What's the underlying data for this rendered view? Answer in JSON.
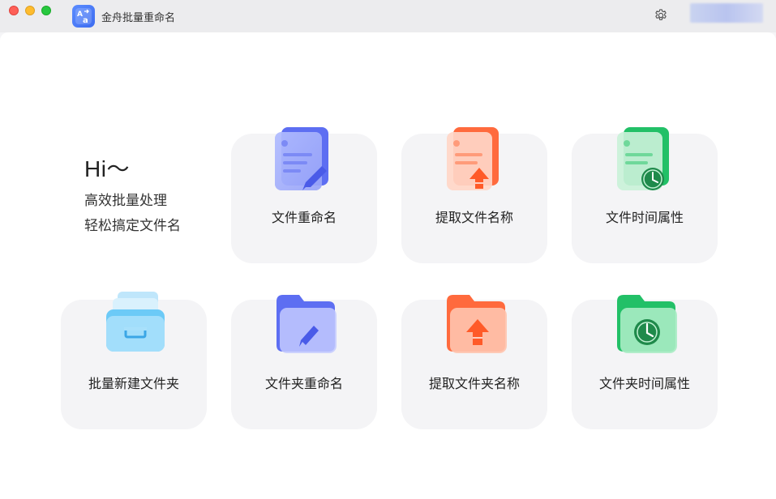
{
  "window": {
    "title": "金舟批量重命名",
    "traffic_lights": [
      "close",
      "minimize",
      "maximize"
    ]
  },
  "toolbar": {
    "settings_icon": "gear-icon",
    "account": "account-area-blurred"
  },
  "greeting": {
    "hi": "Hi～",
    "line1": "高效批量处理",
    "line2": "轻松搞定文件名"
  },
  "features": [
    {
      "label": "文件重命名",
      "icon": "file-rename-icon",
      "color": "#5b6ef0"
    },
    {
      "label": "提取文件名称",
      "icon": "file-extract-icon",
      "color": "#ff6a3d"
    },
    {
      "label": "文件时间属性",
      "icon": "file-time-icon",
      "color": "#22c067"
    },
    {
      "label": "批量新建文件夹",
      "icon": "folder-batch-create-icon",
      "color": "#3fb4f5"
    },
    {
      "label": "文件夹重命名",
      "icon": "folder-rename-icon",
      "color": "#5b6ef0"
    },
    {
      "label": "提取文件夹名称",
      "icon": "folder-extract-icon",
      "color": "#ff6a3d"
    },
    {
      "label": "文件夹时间属性",
      "icon": "folder-time-icon",
      "color": "#22c067"
    }
  ]
}
